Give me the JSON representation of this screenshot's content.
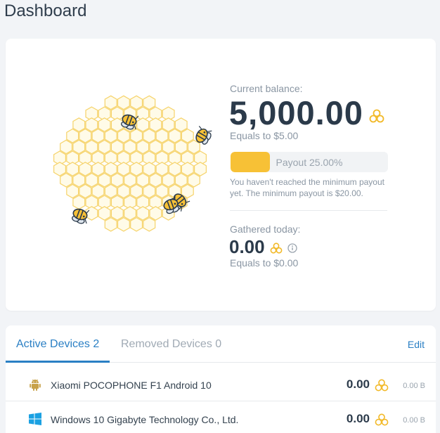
{
  "page": {
    "title": "Dashboard"
  },
  "balance": {
    "label": "Current balance:",
    "value": "5,000.00",
    "equals": "Equals to $5.00",
    "progress_percent": 25,
    "progress_text": "Payout 25.00%",
    "note": "You haven't reached the minimum payout yet. The minimum payout is $20.00."
  },
  "today": {
    "label": "Gathered today:",
    "value": "0.00",
    "equals": "Equals to $0.00"
  },
  "devices": {
    "tabs": [
      {
        "label": "Active Devices 2",
        "active": true
      },
      {
        "label": "Removed Devices 0",
        "active": false
      }
    ],
    "edit_label": "Edit",
    "rows": [
      {
        "name": "Xiaomi POCOPHONE F1 Android 10",
        "icon": "android-icon",
        "value": "0.00",
        "unit": "0.00 B"
      },
      {
        "name": "Windows 10 Gigabyte Technology Co., Ltd.",
        "icon": "windows-icon",
        "value": "0.00",
        "unit": "0.00 B"
      }
    ]
  },
  "colors": {
    "accent": "#2a7fc4",
    "honey": "#f7c136",
    "text": "#2b3a4a",
    "muted": "#8a96a3"
  }
}
